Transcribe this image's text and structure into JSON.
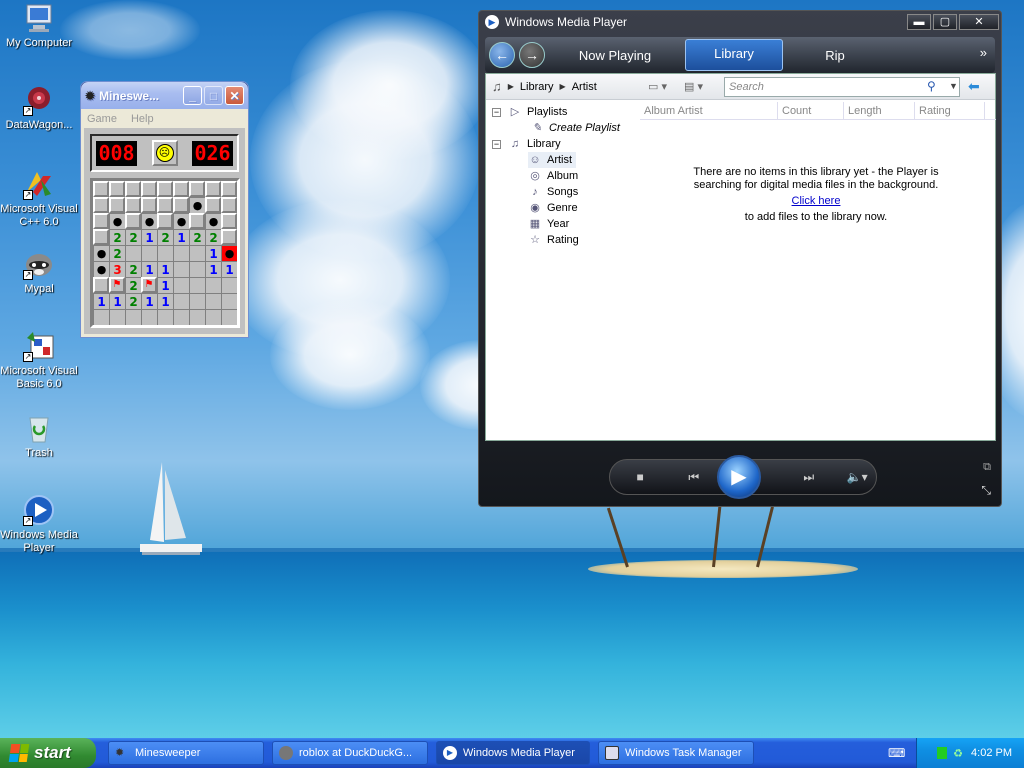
{
  "desktop": {
    "icons": [
      {
        "label": "My Computer"
      },
      {
        "label": "DataWagon..."
      },
      {
        "label": "Microsoft Visual C++ 6.0"
      },
      {
        "label": "Mypal"
      },
      {
        "label": "Microsoft Visual Basic 6.0"
      },
      {
        "label": "Trash"
      },
      {
        "label": "Windows Media Player"
      }
    ]
  },
  "minesweeper": {
    "title": "Minesweeper",
    "title_display": "Mineswe...",
    "menu": [
      "Game",
      "Help"
    ],
    "mine_counter": "008",
    "timer": "026",
    "face": "dead",
    "grid": [
      [
        "u",
        "u",
        "u",
        "u",
        "u",
        "u",
        "u",
        "u",
        "u"
      ],
      [
        "u",
        "u",
        "u",
        "u",
        "u",
        "u",
        "m",
        "u",
        "u"
      ],
      [
        "u",
        "m",
        "u",
        "m",
        "u",
        "m",
        "u",
        "m",
        "u"
      ],
      [
        "u",
        "2",
        "2",
        "1",
        "2",
        "1",
        "2",
        "2",
        "u"
      ],
      [
        "m",
        "2",
        "o",
        "o",
        "o",
        "o",
        "o",
        "1",
        "mr"
      ],
      [
        "m",
        "3",
        "2",
        "1",
        "1",
        "o",
        "o",
        "1",
        "1"
      ],
      [
        "u",
        "f",
        "2",
        "f",
        "1",
        "o",
        "o",
        "o",
        "o"
      ],
      [
        "1",
        "1",
        "2",
        "1",
        "1",
        "o",
        "o",
        "o",
        "o"
      ],
      [
        "o",
        "o",
        "o",
        "o",
        "o",
        "o",
        "o",
        "o",
        "o"
      ]
    ]
  },
  "wmp": {
    "title": "Windows Media Player",
    "tabs": [
      "Now Playing",
      "Library",
      "Rip"
    ],
    "active_tab": "Library",
    "breadcrumb": [
      "Library",
      "Artist"
    ],
    "search_placeholder": "Search",
    "tree": {
      "playlists": "Playlists",
      "create_playlist": "Create Playlist",
      "library": "Library",
      "items": [
        "Artist",
        "Album",
        "Songs",
        "Genre",
        "Year",
        "Rating"
      ]
    },
    "columns": [
      "Album Artist",
      "Count",
      "Length",
      "Rating"
    ],
    "empty_message_1": "There are no items in this library yet - the Player is searching for digital media files in the background.",
    "click_here": "Click here",
    "empty_message_2": "to add files to the library now."
  },
  "taskbar": {
    "start_label": "start",
    "buttons": [
      "Minesweeper",
      "roblox at DuckDuckG...",
      "Windows Media Player",
      "Windows Task Manager"
    ],
    "clock": "4:02 PM"
  },
  "colors": {
    "xp_blue": "#245edb",
    "start_green": "#318a31",
    "wmp_dark": "#14171c",
    "mine_red": "#ff0000"
  }
}
